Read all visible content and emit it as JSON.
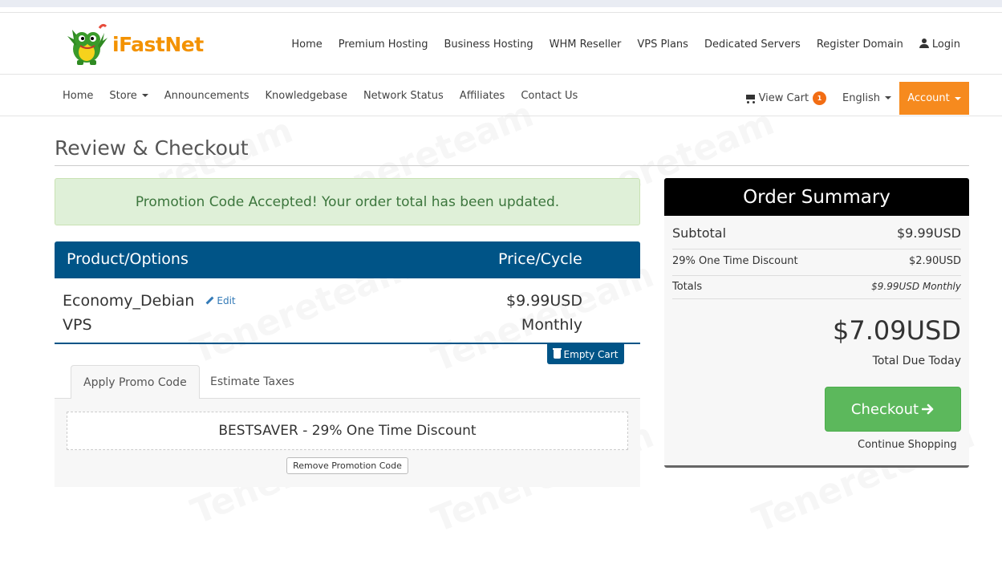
{
  "brand": {
    "name": "iFastNet"
  },
  "topnav": {
    "items": [
      "Home",
      "Premium Hosting",
      "Business Hosting",
      "WHM Reseller",
      "VPS Plans",
      "Dedicated Servers",
      "Register Domain"
    ],
    "login": "Login"
  },
  "mainnav": {
    "items": [
      "Home",
      "Store",
      "Announcements",
      "Knowledgebase",
      "Network Status",
      "Affiliates",
      "Contact Us"
    ],
    "view_cart": "View Cart",
    "cart_count": "1",
    "language": "English",
    "account": "Account"
  },
  "page": {
    "title": "Review & Checkout"
  },
  "alert": {
    "message": "Promotion Code Accepted! Your order total has been updated."
  },
  "cart": {
    "col_product": "Product/Options",
    "col_price": "Price/Cycle",
    "item": {
      "name_line1": "Economy_Debian",
      "name_line2": "VPS",
      "edit": "Edit",
      "price": "$9.99USD",
      "cycle": "Monthly"
    },
    "empty_cart": "Empty Cart"
  },
  "tabs": {
    "promo": "Apply Promo Code",
    "taxes": "Estimate Taxes"
  },
  "promo": {
    "applied": "BESTSAVER - 29% One Time Discount",
    "remove": "Remove Promotion Code"
  },
  "summary": {
    "title": "Order Summary",
    "subtotal_label": "Subtotal",
    "subtotal_value": "$9.99USD",
    "discount_label": "29% One Time Discount",
    "discount_value": "$2.90USD",
    "totals_label": "Totals",
    "totals_value": "$9.99USD Monthly",
    "total_due": "$7.09USD",
    "total_due_label": "Total Due Today",
    "checkout": "Checkout",
    "continue": "Continue Shopping"
  },
  "colors": {
    "brand_orange": "#f39200",
    "account_orange": "#f68a1e",
    "table_header_blue": "#005487",
    "checkout_green": "#5cb85c",
    "alert_green_bg": "#dff0d8"
  },
  "watermark": "Tenereteam"
}
